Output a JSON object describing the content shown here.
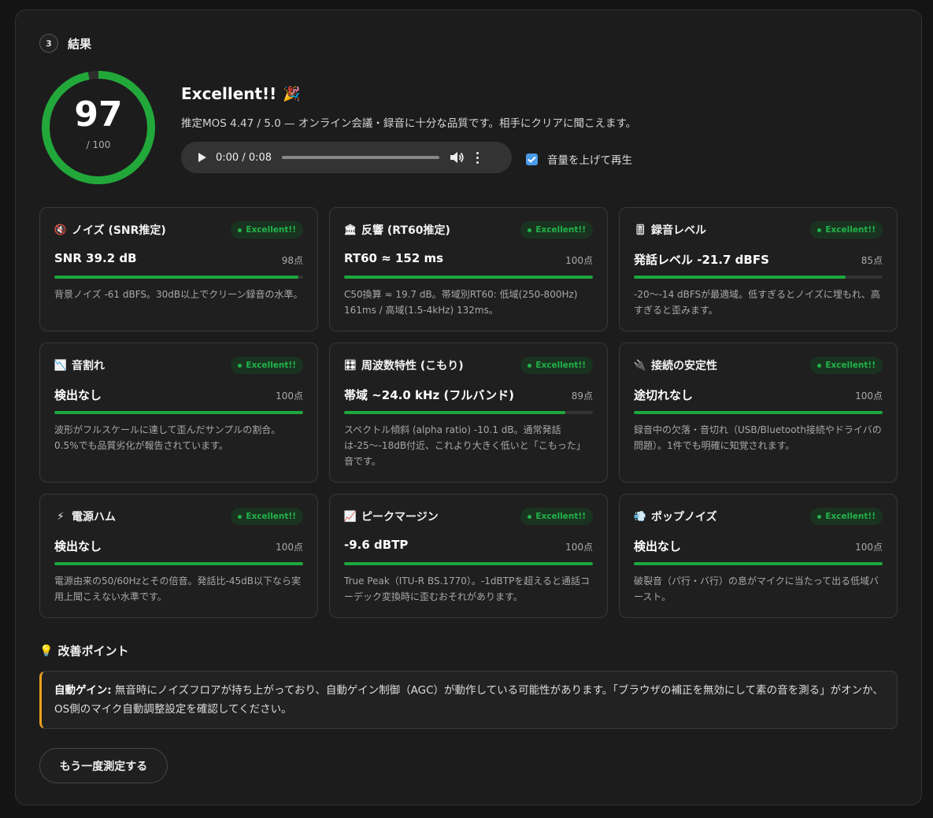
{
  "step": {
    "number": "3",
    "title": "結果"
  },
  "score": {
    "value": "97",
    "max": "/ 100",
    "fraction": 0.97,
    "ring_color": "#22a83a"
  },
  "verdict": {
    "title": "Excellent!!",
    "emoji": "🎉",
    "description": "推定MOS 4.47 / 5.0 — オンライン会議・録音に十分な品質です。相手にクリアに聞こえます。"
  },
  "player": {
    "time": "0:00 / 0:08",
    "play_icon": "play-icon",
    "volume_icon": "volume-icon",
    "more_icon": "more-vert-icon"
  },
  "boost_checkbox": {
    "label": "音量を上げて再生",
    "checked": true
  },
  "cards": [
    {
      "icon": "🔇",
      "icon_name": "muted-speaker-icon",
      "title": "ノイズ (SNR推定)",
      "badge": "Excellent!!",
      "metric": "SNR 39.2 dB",
      "points": "98点",
      "fill": 0.98,
      "desc": "背景ノイズ -61 dBFS。30dB以上でクリーン録音の水準。"
    },
    {
      "icon": "🏛",
      "icon_name": "building-icon",
      "title": "反響 (RT60推定)",
      "badge": "Excellent!!",
      "metric": "RT60 ≈ 152 ms",
      "points": "100点",
      "fill": 1.0,
      "desc": "C50換算 ≈ 19.7 dB。帯域別RT60: 低域(250-800Hz) 161ms / 高域(1.5-4kHz) 132ms。"
    },
    {
      "icon": "🎚",
      "icon_name": "level-slider-icon",
      "title": "録音レベル",
      "badge": "Excellent!!",
      "metric": "発話レベル -21.7 dBFS",
      "points": "85点",
      "fill": 0.85,
      "desc": "-20〜-14 dBFSが最適域。低すぎるとノイズに埋もれ、高すぎると歪みます。"
    },
    {
      "icon": "📉",
      "icon_name": "chart-down-icon",
      "title": "音割れ",
      "badge": "Excellent!!",
      "metric": "検出なし",
      "points": "100点",
      "fill": 1.0,
      "desc": "波形がフルスケールに達して歪んだサンプルの割合。0.5%でも品質劣化が報告されています。"
    },
    {
      "icon": "🎛",
      "icon_name": "control-knobs-icon",
      "title": "周波数特性 (こもり)",
      "badge": "Excellent!!",
      "metric": "帯域 ~24.0 kHz (フルバンド)",
      "points": "89点",
      "fill": 0.89,
      "desc": "スペクトル傾斜 (alpha ratio) -10.1 dB。通常発話は-25〜-18dB付近、これより大きく低いと「こもった」音です。"
    },
    {
      "icon": "🔌",
      "icon_name": "plug-icon",
      "title": "接続の安定性",
      "badge": "Excellent!!",
      "metric": "途切れなし",
      "points": "100点",
      "fill": 1.0,
      "desc": "録音中の欠落・音切れ（USB/Bluetooth接続やドライバの問題）。1件でも明確に知覚されます。"
    },
    {
      "icon": "⚡",
      "icon_name": "lightning-icon",
      "title": "電源ハム",
      "badge": "Excellent!!",
      "metric": "検出なし",
      "points": "100点",
      "fill": 1.0,
      "desc": "電源由来の50/60Hzとその倍音。発話比-45dB以下なら実用上聞こえない水準です。"
    },
    {
      "icon": "📈",
      "icon_name": "chart-up-icon",
      "title": "ピークマージン",
      "badge": "Excellent!!",
      "metric": "-9.6 dBTP",
      "points": "100点",
      "fill": 1.0,
      "desc": "True Peak（ITU-R BS.1770）。-1dBTPを超えると通話コーデック変換時に歪むおそれがあります。"
    },
    {
      "icon": "💨",
      "icon_name": "dash-icon",
      "title": "ポップノイズ",
      "badge": "Excellent!!",
      "metric": "検出なし",
      "points": "100点",
      "fill": 1.0,
      "desc": "破裂音（パ行・バ行）の息がマイクに当たって出る低域バースト。"
    }
  ],
  "tips": {
    "icon": "💡",
    "title": "改善ポイント",
    "label": "自動ゲイン:",
    "text": " 無音時にノイズフロアが持ち上がっており、自動ゲイン制御（AGC）が動作している可能性があります。「ブラウザの補正を無効にして素の音を測る」がオンか、OS側のマイク自動調整設定を確認してください。"
  },
  "retry_button": "もう一度測定する"
}
